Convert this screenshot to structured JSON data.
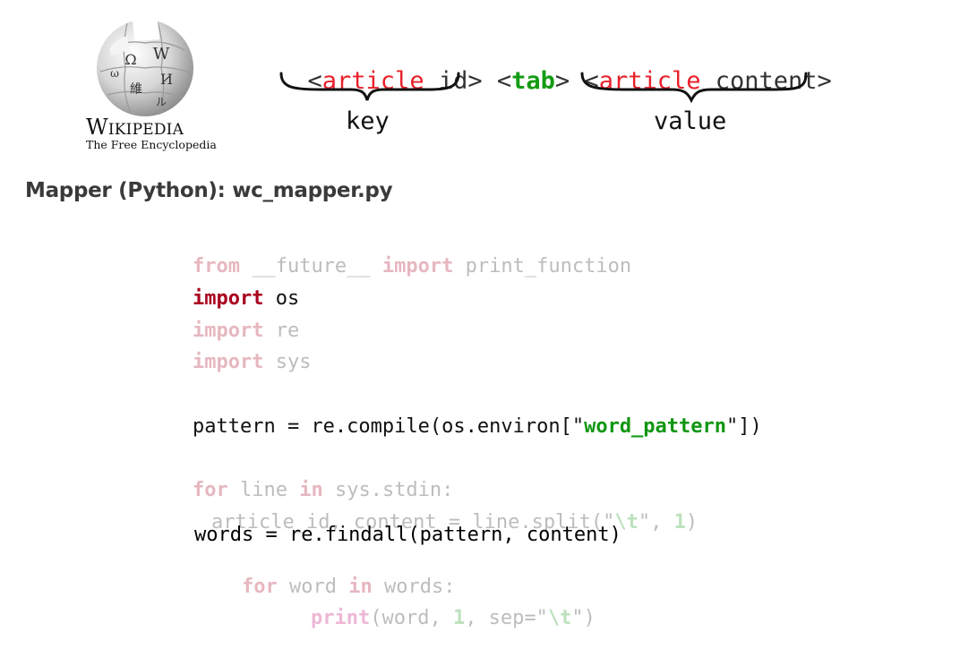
{
  "logo": {
    "globe_icon": "wikipedia-puzzle-globe-icon",
    "wordmark": "Wikipedia",
    "tagline": "The Free Encyclopedia",
    "glyphs": [
      "W",
      "Ω",
      "И",
      "維",
      "ω",
      "ル"
    ]
  },
  "diagram": {
    "article_id_open": "<",
    "article_id_kw": "article",
    "article_id_rest": " id>",
    "tab_open": "<",
    "tab_kw": "tab",
    "tab_close": ">",
    "content_open": "<",
    "content_kw": "article",
    "content_rest": " content>",
    "key_label": "key",
    "value_label": "value",
    "colors": {
      "keyword": "#e8202a",
      "tab": "#139b13"
    }
  },
  "section": {
    "title": "Mapper (Python): wc_mapper.py"
  },
  "code": {
    "l1_kw1": "from",
    "l1_mod": " __future__ ",
    "l1_kw2": "import",
    "l1_rest": " print_function",
    "l2_kw": "import",
    "l2_rest": " os",
    "l3_kw": "import",
    "l3_rest": " re",
    "l4_kw": "import",
    "l4_rest": " sys",
    "l5_a": "pattern = re.compile(os.environ[\"",
    "l5_str": "word_pattern",
    "l5_b": "\"])",
    "l6_kw1": "for",
    "l6_a": " line ",
    "l6_kw2": "in",
    "l6_b": " sys.stdin:",
    "l7_a": "article_id, content = line.split(\"",
    "l7_str": "\\t",
    "l7_b": "\", ",
    "l7_num": "1",
    "l7_c": ")",
    "l8": "words = re.findall(pattern, content)",
    "l9_kw1": "for",
    "l9_a": " word ",
    "l9_kw2": "in",
    "l9_b": " words:",
    "l10_kw": "print",
    "l10_a": "(word, ",
    "l10_num": "1",
    "l10_b": ", sep=\"",
    "l10_str": "\\t",
    "l10_c": "\")"
  }
}
